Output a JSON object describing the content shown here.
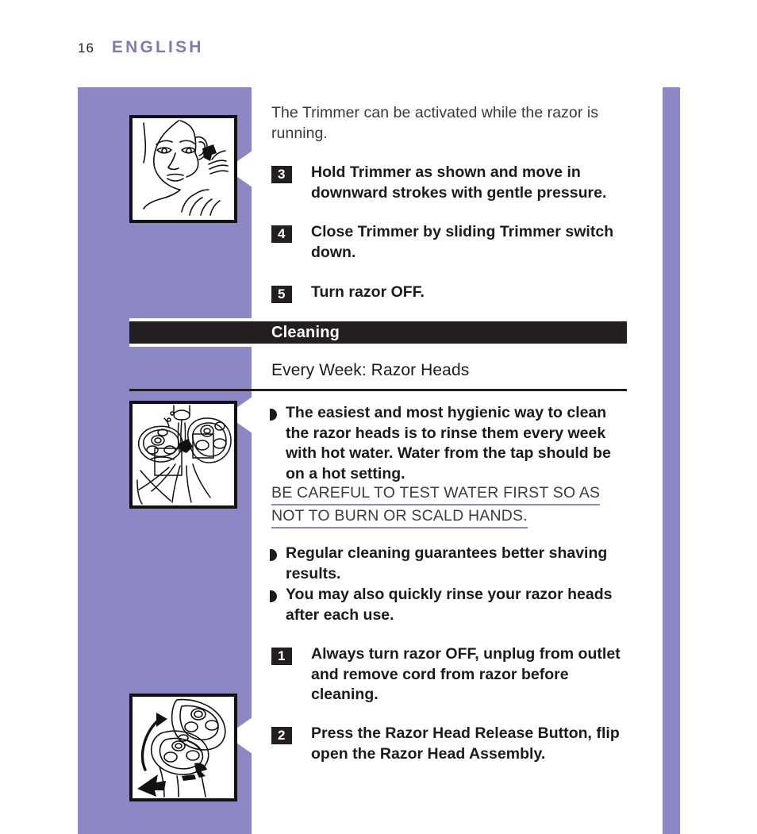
{
  "header": {
    "folio": "16",
    "language": "ENGLISH"
  },
  "colors": {
    "band_purple": "#8b87c4",
    "banner_black": "#231f20",
    "title_purple": "#7f7bbb",
    "warning_underline": "#8b87c4"
  },
  "intro": {
    "text": "The Trimmer can be activated while the razor is running."
  },
  "trimmer_steps": [
    {
      "num": "3",
      "text": "Hold Trimmer as shown and move in downward strokes with gentle pressure."
    },
    {
      "num": "4",
      "text": "Close Trimmer by sliding Trimmer switch down."
    },
    {
      "num": "5",
      "text": "Turn razor OFF."
    }
  ],
  "section": {
    "banner_label": "Cleaning",
    "subhead": "Every Week: Razor Heads"
  },
  "bullets": [
    {
      "text": "The easiest and most hygienic way to clean the razor heads is to rinse them every week with hot water. Water from the tap should be on a hot setting."
    },
    {
      "text": "Regular cleaning guarantees better shaving results."
    },
    {
      "text": "You may also quickly rinse your razor heads after each use."
    }
  ],
  "warning": {
    "line1": "BE CAREFUL TO TEST WATER FIRST SO AS",
    "line2": "NOT TO BURN OR SCALD HANDS."
  },
  "cleaning_steps": [
    {
      "num": "1",
      "text": "Always turn razor OFF, unplug from outlet and remove cord from razor before cleaning."
    },
    {
      "num": "2",
      "text": "Press the Razor Head Release Button, flip open the Razor Head Assembly."
    }
  ],
  "figures": [
    {
      "caption": "man-trimming-sideburn-illustration"
    },
    {
      "caption": "rinsing-razor-heads-under-tap-illustration"
    },
    {
      "caption": "flip-open-razor-head-assembly-illustration"
    }
  ]
}
